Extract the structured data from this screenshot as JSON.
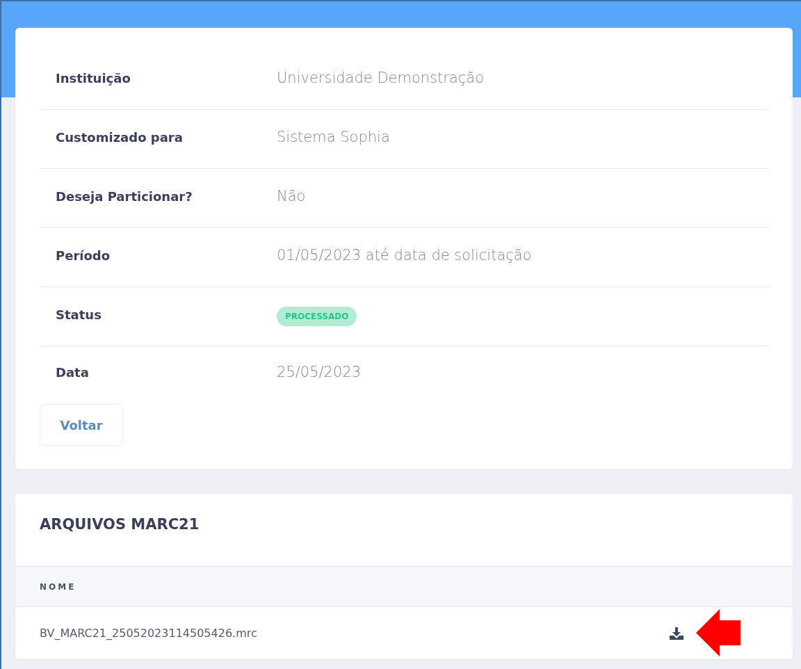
{
  "details": [
    {
      "label": "Instituição",
      "value": "Universidade Demonstração",
      "kind": "text"
    },
    {
      "label": "Customizado para",
      "value": "Sistema Sophia",
      "kind": "text"
    },
    {
      "label": "Deseja Particionar?",
      "value": "Não",
      "kind": "text"
    },
    {
      "label": "Período",
      "value": "01/05/2023 até data de solicitação",
      "kind": "text"
    },
    {
      "label": "Status",
      "value": "PROCESSADO",
      "kind": "badge"
    },
    {
      "label": "Data",
      "value": "25/05/2023",
      "kind": "text"
    }
  ],
  "back_button": "Voltar",
  "files": {
    "title": "ARQUIVOS MARC21",
    "columns": [
      "NOME"
    ],
    "rows": [
      {
        "name": "BV_MARC21_25052023114505426.mrc",
        "highlighted": true
      }
    ]
  }
}
